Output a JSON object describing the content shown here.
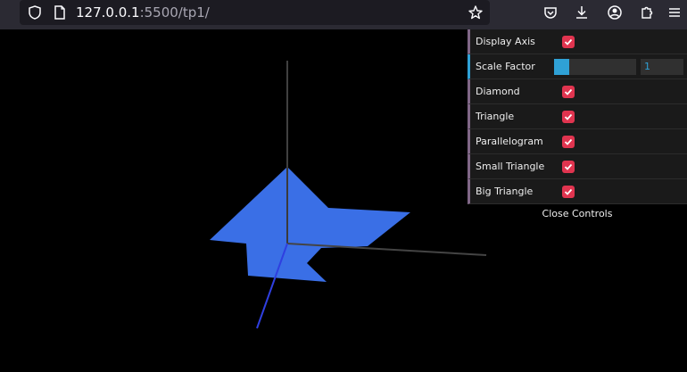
{
  "browser": {
    "url_host": "127.0.0.1",
    "url_path": ":5500/tp1/"
  },
  "icons": {
    "shield": "shield-icon",
    "page": "page-icon",
    "bookmark": "star-icon",
    "pocket": "pocket-icon",
    "download": "download-icon",
    "account": "account-icon",
    "extensions": "extensions-icon",
    "menu": "hamburger-menu-icon"
  },
  "controls": {
    "display_axis": {
      "label": "Display Axis",
      "checked": true
    },
    "scale_factor": {
      "label": "Scale Factor",
      "value": "1",
      "fraction": 0.18
    },
    "diamond": {
      "label": "Diamond",
      "checked": true
    },
    "triangle": {
      "label": "Triangle",
      "checked": true
    },
    "parallelogram": {
      "label": "Parallelogram",
      "checked": true
    },
    "small_triangle": {
      "label": "Small Triangle",
      "checked": true
    },
    "big_triangle": {
      "label": "Big Triangle",
      "checked": true
    },
    "close_label": "Close Controls"
  },
  "colors": {
    "shape_fill": "#3a6fe6",
    "checkbox": "#e0344f",
    "slider": "#2fa1d6",
    "boolean_accent": "#806787"
  }
}
